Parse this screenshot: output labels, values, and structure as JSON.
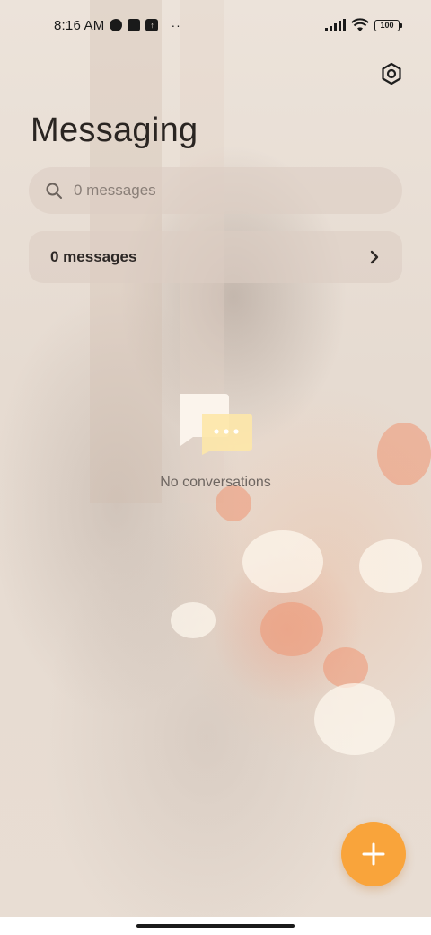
{
  "status_bar": {
    "time": "8:16 AM",
    "battery": "100",
    "icons": [
      "messenger-icon",
      "square-notification-icon",
      "upload-icon",
      "more-dots-icon",
      "signal-icon",
      "wifi-icon",
      "battery-icon"
    ]
  },
  "header": {
    "title": "Messaging",
    "settings_icon": "gear-icon"
  },
  "search": {
    "placeholder": "0 messages",
    "value": ""
  },
  "summary_card": {
    "label": "0 messages"
  },
  "empty_state": {
    "text": "No conversations",
    "icon": "chat-bubbles-icon"
  },
  "fab": {
    "icon": "plus-icon"
  },
  "colors": {
    "accent": "#f9a43b",
    "bubble_front": "#fde7a8",
    "bubble_back": "#fbf4ec"
  }
}
